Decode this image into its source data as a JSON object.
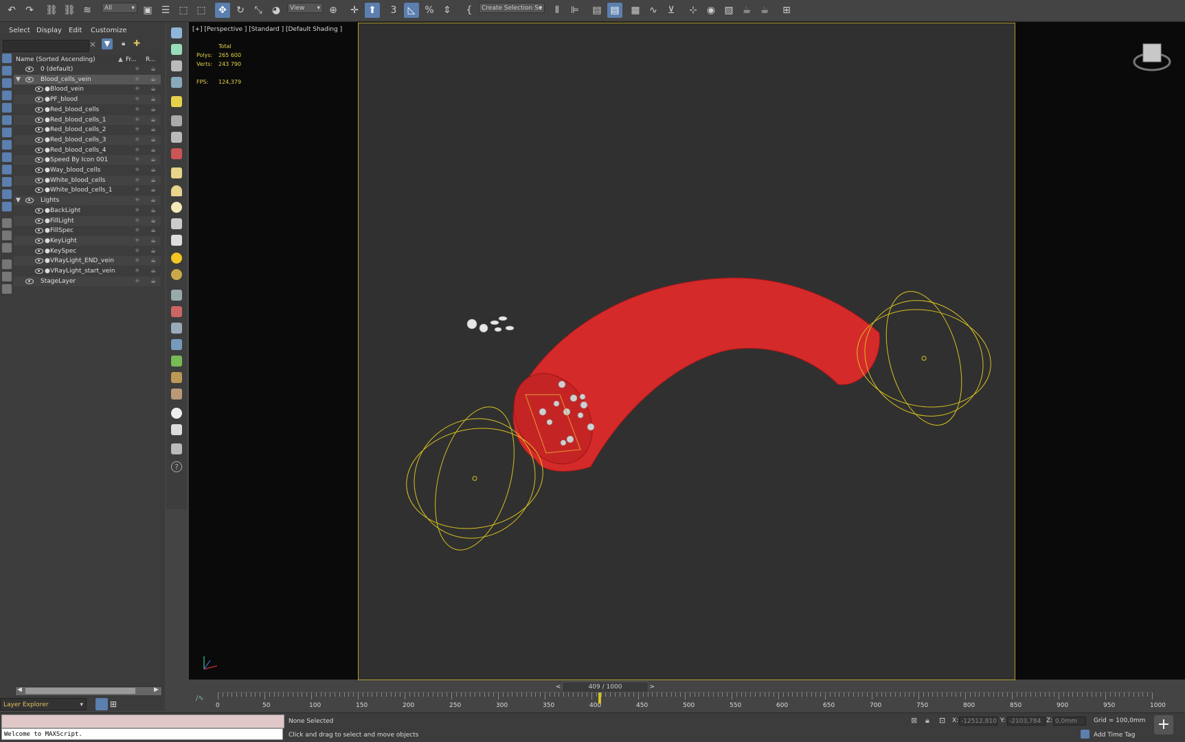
{
  "toolbar": {
    "selection_filter": "All",
    "ref_coord": "View",
    "named_selection": "Create Selection Se"
  },
  "explorer": {
    "menus": [
      "Select",
      "Display",
      "Edit",
      "Customize"
    ],
    "column_name": "Name (Sorted Ascending)",
    "column_frozen": "Fr...",
    "column_render": "R...",
    "items": [
      {
        "name": "0 (default)",
        "level": 0
      },
      {
        "name": "Blood_cells_vein",
        "level": 0
      },
      {
        "name": "Blood_vein",
        "level": 1
      },
      {
        "name": "PF_blood",
        "level": 1
      },
      {
        "name": "Red_blood_cells",
        "level": 1
      },
      {
        "name": "Red_blood_cells_1",
        "level": 1
      },
      {
        "name": "Red_blood_cells_2",
        "level": 1
      },
      {
        "name": "Red_blood_cells_3",
        "level": 1
      },
      {
        "name": "Red_blood_cells_4",
        "level": 1
      },
      {
        "name": "Speed By Icon 001",
        "level": 1
      },
      {
        "name": "Way_blood_cells",
        "level": 1
      },
      {
        "name": "White_blood_cells",
        "level": 1
      },
      {
        "name": "White_blood_cells_1",
        "level": 1
      },
      {
        "name": "Lights",
        "level": 0
      },
      {
        "name": "BackLight",
        "level": 1
      },
      {
        "name": "FillLight",
        "level": 1
      },
      {
        "name": "FillSpec",
        "level": 1
      },
      {
        "name": "KeyLight",
        "level": 1
      },
      {
        "name": "KeySpec",
        "level": 1
      },
      {
        "name": "VRayLight_END_vein",
        "level": 1
      },
      {
        "name": "VRayLight_start_vein",
        "level": 1
      },
      {
        "name": "StageLayer",
        "level": 0
      }
    ],
    "layer_explorer": "Layer Explorer"
  },
  "viewport": {
    "label": "[+] [Perspective ] [Standard ] [Default Shading ]",
    "stats_header": "Total",
    "polys_label": "Polys:",
    "polys": "265 600",
    "verts_label": "Verts:",
    "verts": "243 790",
    "fps_label": "FPS:",
    "fps": "124,379"
  },
  "timeline": {
    "frame": "409 / 1000",
    "current": 409,
    "ticks": [
      "0",
      "50",
      "100",
      "150",
      "200",
      "250",
      "300",
      "350",
      "400",
      "450",
      "500",
      "550",
      "600",
      "650",
      "700",
      "750",
      "800",
      "850",
      "900",
      "950",
      "1000"
    ]
  },
  "status": {
    "selection": "None Selected",
    "prompt": "Click and drag to select and move objects",
    "maxscript": "Welcome to MAXScript.",
    "x_label": "X:",
    "x": "-12512,810",
    "y_label": "Y:",
    "y": "-2103,784",
    "z_label": "Z:",
    "z": "0,0mm",
    "grid": "Grid = 100,0mm",
    "add_time_tag": "Add Time Tag"
  },
  "colors": {
    "accent": "#5b7fae",
    "vein": "#d42a2a",
    "gizmo": "#d9c31f",
    "stats": "#e6d24a"
  }
}
